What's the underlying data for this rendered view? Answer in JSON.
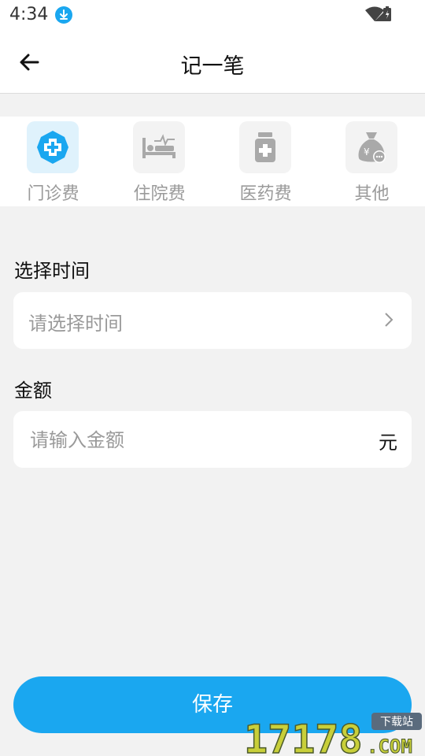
{
  "status_bar": {
    "time": "4:34"
  },
  "header": {
    "title": "记一笔"
  },
  "categories": [
    {
      "label": "门诊费",
      "icon": "hospital-cross-icon",
      "active": true
    },
    {
      "label": "住院费",
      "icon": "hospital-bed-icon",
      "active": false
    },
    {
      "label": "医药费",
      "icon": "medicine-bottle-icon",
      "active": false
    },
    {
      "label": "其他",
      "icon": "money-bag-icon",
      "active": false
    }
  ],
  "time_section": {
    "label": "选择时间",
    "placeholder": "请选择时间"
  },
  "amount_section": {
    "label": "金额",
    "placeholder": "请输入金额",
    "unit": "元"
  },
  "save_button": {
    "label": "保存"
  },
  "watermark": {
    "number": "17178",
    "suffix": ".COM",
    "badge": "下载站"
  },
  "colors": {
    "accent": "#1aa7f0",
    "active_bg": "#dff2fc",
    "icon_grey": "#a9a9a9"
  }
}
